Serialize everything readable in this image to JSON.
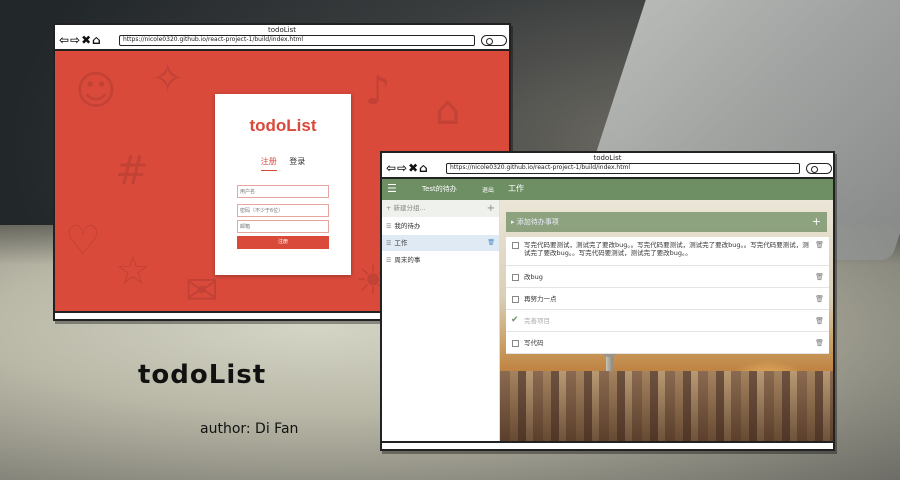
{
  "caption": {
    "title": "todoList",
    "author": "author: Di Fan"
  },
  "background": {
    "apple_logo": "apple-logo"
  },
  "login_window": {
    "window_title": "todoList",
    "url": "https://nicole0320.github.io/react-project-1/build/index.html",
    "nav_icons": "⇦⇨✖⌂",
    "accent_color": "#d94a3b",
    "card": {
      "brand": "todoList",
      "tabs": [
        {
          "label": "注册",
          "active": true
        },
        {
          "label": "登录",
          "active": false
        }
      ],
      "fields": {
        "username_placeholder": "用户名",
        "password_placeholder": "密码（不少于6位）",
        "email_placeholder": "邮箱"
      },
      "submit_label": "注册"
    }
  },
  "todo_window": {
    "window_title": "todoList",
    "url": "https://nicole0320.github.io/react-project-1/build/index.html",
    "nav_icons": "⇦⇨✖⌂",
    "accent_color": "#6e8f64",
    "appbar": {
      "menu_icon": "☰",
      "user_title": "Test的待办",
      "logout_label": "退出",
      "current_list": "工作"
    },
    "sidebar": {
      "new_group_placeholder": "+ 新建分组...",
      "new_group_plus": "+",
      "groups": [
        {
          "label": "我的待办",
          "active": false
        },
        {
          "label": "工作",
          "active": true
        },
        {
          "label": "周末的事",
          "active": false
        }
      ]
    },
    "main": {
      "add_todo_placeholder": "▸ 添加待办事项",
      "add_plus": "+",
      "todos": [
        {
          "text": "写完代码要测试，测试完了要改bug。。写完代码要测试，测试完了要改bug。。写完代码要测试，测试完了要改bug。。写完代码要测试，测试完了要改bug。。",
          "done": false
        },
        {
          "text": "改bug",
          "done": false
        },
        {
          "text": "再努力一点",
          "done": false
        },
        {
          "text": "完善项目",
          "done": true
        },
        {
          "text": "写代码",
          "done": false
        }
      ]
    }
  }
}
